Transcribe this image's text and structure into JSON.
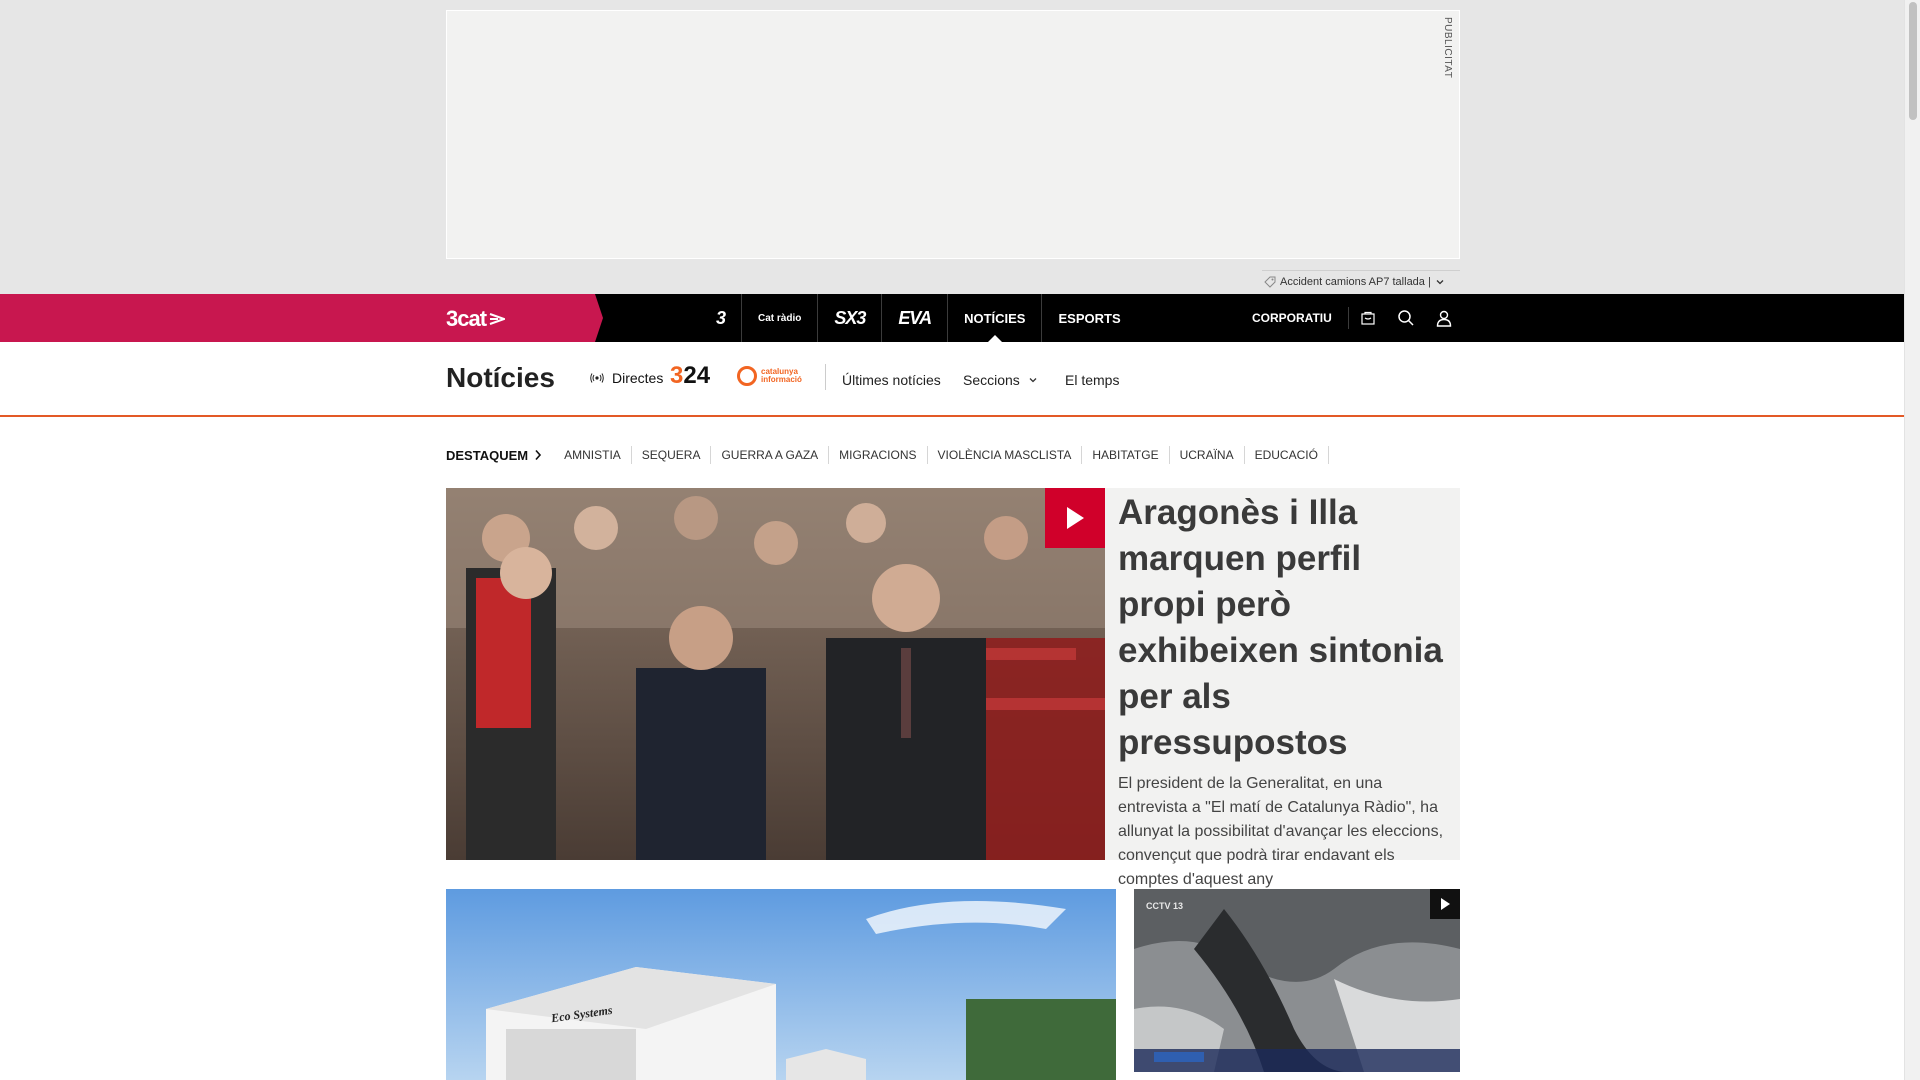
{
  "ad": {
    "label": "PUBLICITAT"
  },
  "ticker": {
    "text": "Accident camions AP7 tallada |"
  },
  "topbar": {
    "brand": "3cat",
    "channels": [
      {
        "label": "3",
        "name": "channel-tv3"
      },
      {
        "label": "Cat ràdio",
        "name": "channel-catradio"
      },
      {
        "label": "SX3",
        "name": "channel-sx3"
      },
      {
        "label": "EVA",
        "name": "channel-eva"
      },
      {
        "label": "NOTÍCIES",
        "name": "channel-noticies"
      },
      {
        "label": "ESPORTS",
        "name": "channel-esports"
      }
    ],
    "corporate": "CORPORATIU"
  },
  "section": {
    "title": "Notícies",
    "live": "Directes",
    "logo_324": {
      "prefix": "3",
      "suffix": "24"
    },
    "logo_ci": {
      "line1": "catalunya",
      "line2": "informació"
    },
    "links": [
      "Últimes notícies",
      "Seccions",
      "El temps"
    ]
  },
  "destaquem": {
    "title": "DESTAQUEM",
    "items": [
      "AMNISTIA",
      "SEQUERA",
      "GUERRA A GAZA",
      "MIGRACIONS",
      "VIOLÈNCIA MASCLISTA",
      "HABITATGE",
      "UCRAÏNA",
      "EDUCACIÓ"
    ]
  },
  "hero": {
    "title": "Aragonès i Illa marquen perfil propi però exhibeixen sintonia per als pressupostos",
    "lead": "El president de la Generalitat, en una entrevista a \"El matí de Catalunya Ràdio\", ha allunyat la possibilitat d'avançar les eleccions, convençut que podrà tirar endavant els comptes d'aquest any"
  },
  "secondary": {
    "truck_text": "Eco Systems",
    "video_channel": "CCTV 13"
  },
  "colors": {
    "brand": "#c8174f",
    "accent": "#e35926",
    "play": "#d0002a"
  }
}
